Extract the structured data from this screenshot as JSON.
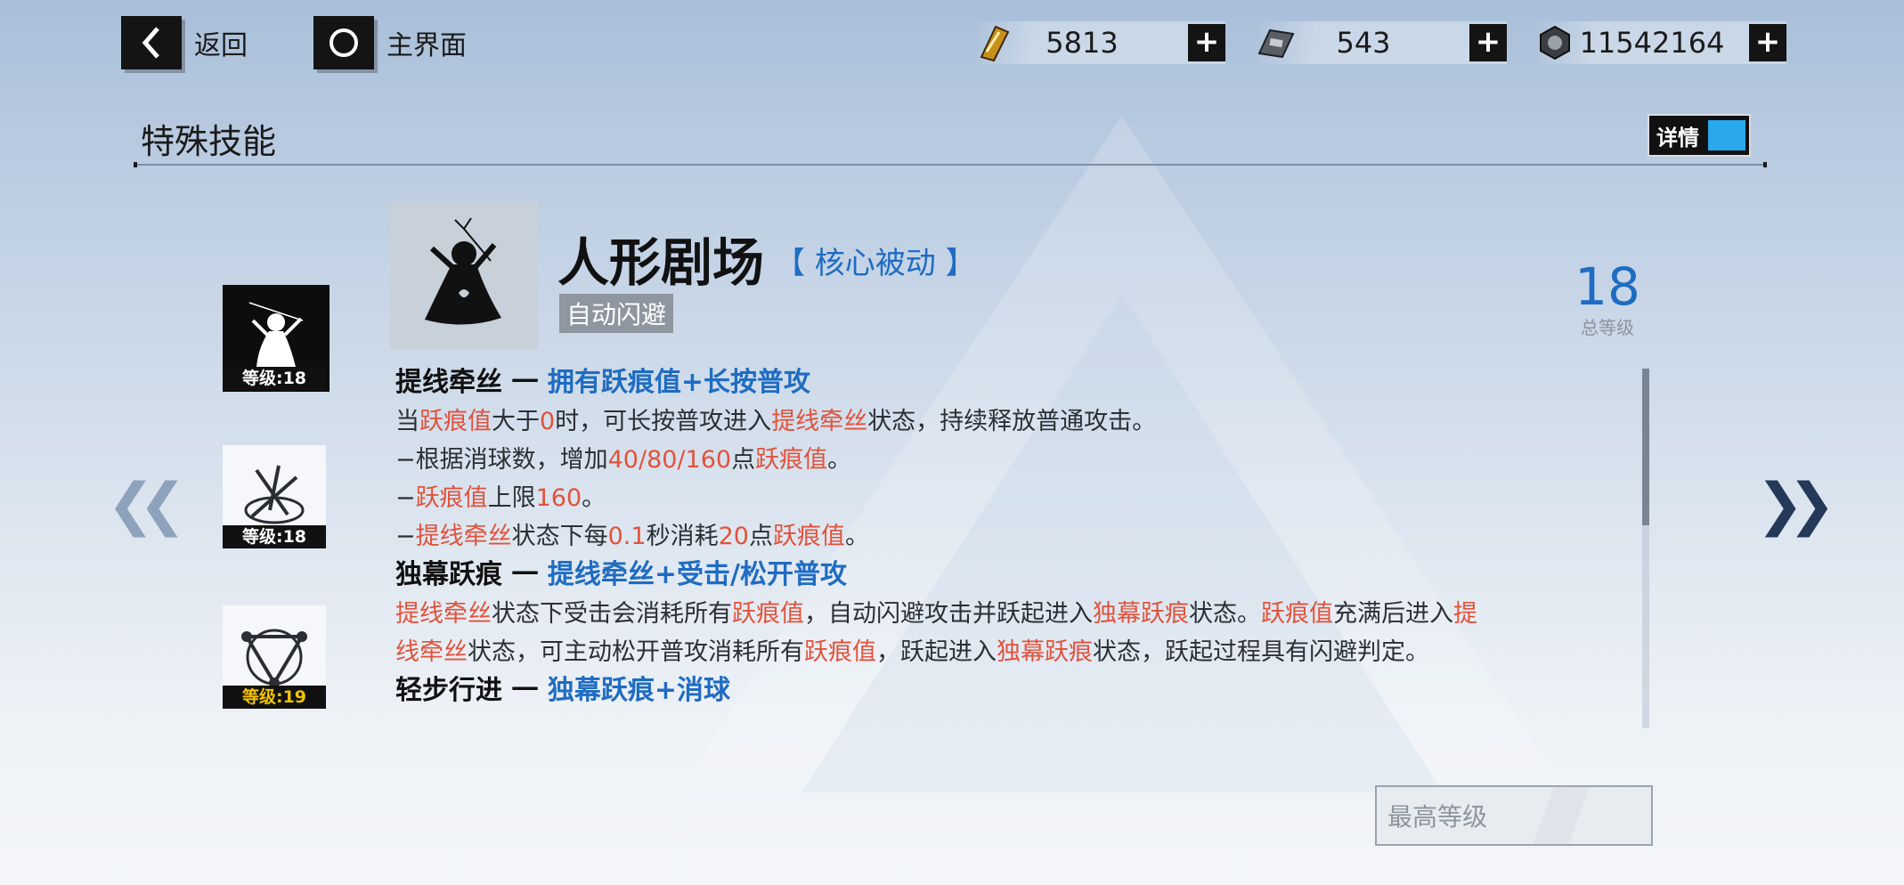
{
  "topbar": {
    "back_label": "返回",
    "home_label": "主界面",
    "resources": [
      {
        "icon": "gold-card-icon",
        "value": "5813"
      },
      {
        "icon": "chip-card-icon",
        "value": "543"
      },
      {
        "icon": "hex-nut-icon",
        "value": "11542164"
      }
    ],
    "plus": "+"
  },
  "section": {
    "title": "特殊技能",
    "details_label": "详情"
  },
  "skill_list": [
    {
      "level": "等级:18",
      "selected": true,
      "level_color": "#ffffff"
    },
    {
      "level": "等级:18",
      "selected": false,
      "level_color": "#ffffff"
    },
    {
      "level": "等级:19",
      "selected": false,
      "level_color": "#f2c200"
    }
  ],
  "skill": {
    "name": "人形剧场",
    "type": "【 核心被动 】",
    "tag": "自动闪避",
    "total_level": "18",
    "total_level_label": "总等级"
  },
  "description": {
    "h1_title": "提线牵丝 一 ",
    "h1_cond": "拥有跃痕值+长按普攻",
    "p1": [
      [
        [
          "当",
          0
        ],
        [
          "跃痕值",
          1
        ],
        [
          "大于",
          0
        ],
        [
          "0",
          1
        ],
        [
          "时，可长按普攻进入",
          0
        ],
        [
          "提线牵丝",
          1
        ],
        [
          "状态，持续释放普通攻击。",
          0
        ]
      ],
      [
        [
          "−根据消球数，增加",
          0
        ],
        [
          "40/80/160",
          1
        ],
        [
          "点",
          0
        ],
        [
          "跃痕值",
          1
        ],
        [
          "。",
          0
        ]
      ],
      [
        [
          "−",
          0
        ],
        [
          "跃痕值",
          1
        ],
        [
          "上限",
          0
        ],
        [
          "160",
          1
        ],
        [
          "。",
          0
        ]
      ],
      [
        [
          "−",
          0
        ],
        [
          "提线牵丝",
          1
        ],
        [
          "状态下每",
          0
        ],
        [
          "0.1",
          1
        ],
        [
          "秒消耗",
          0
        ],
        [
          "20",
          1
        ],
        [
          "点",
          0
        ],
        [
          "跃痕值",
          1
        ],
        [
          "。",
          0
        ]
      ]
    ],
    "h2_title": "独幕跃痕 一 ",
    "h2_cond": "提线牵丝+受击/松开普攻",
    "p2": [
      [
        [
          "提线牵丝",
          1
        ],
        [
          "状态下受击会消耗所有",
          0
        ],
        [
          "跃痕值",
          1
        ],
        [
          "，自动闪避攻击并跃起进入",
          0
        ],
        [
          "独幕跃痕",
          1
        ],
        [
          "状态。",
          0
        ],
        [
          "跃痕值",
          1
        ],
        [
          "充满后进入",
          0
        ],
        [
          "提",
          1
        ]
      ],
      [
        [
          "线牵丝",
          1
        ],
        [
          "状态，可主动松开普攻消耗所有",
          0
        ],
        [
          "跃痕值",
          1
        ],
        [
          "，跃起进入",
          0
        ],
        [
          "独幕跃痕",
          1
        ],
        [
          "状态，跃起过程具有闪避判定。",
          0
        ]
      ]
    ],
    "h3_title": "轻步行进 一 ",
    "h3_cond": "独幕跃痕+消球"
  },
  "max_level_label": "最高等级"
}
